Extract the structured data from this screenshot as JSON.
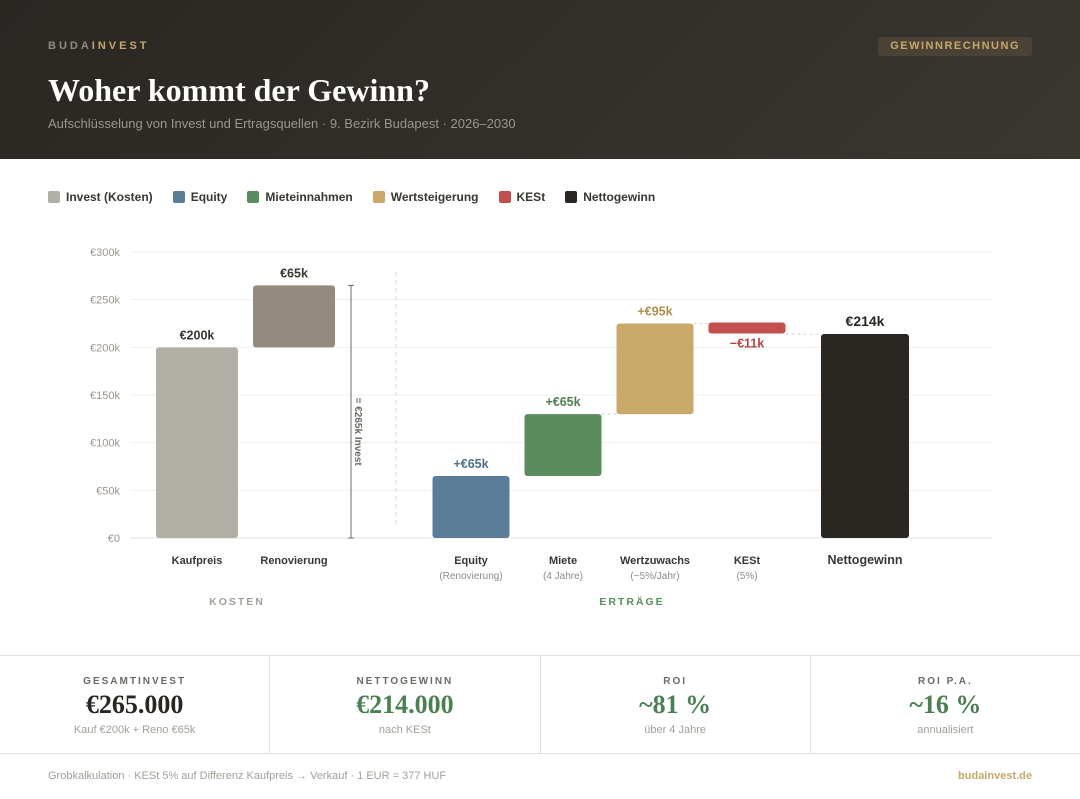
{
  "header": {
    "brand_part1": "BUDA",
    "brand_part2": "INVEST",
    "badge": "GEWINNRECHNUNG",
    "title": "Woher kommt der Gewinn?",
    "subtitle": "Aufschlüsselung von Invest und Ertragsquellen · 9. Bezirk Budapest · 2026–2030"
  },
  "legend": [
    {
      "label": "Invest (Kosten)",
      "color": "#b2afa7"
    },
    {
      "label": "Equity",
      "color": "#5b7d98"
    },
    {
      "label": "Mieteinnahmen",
      "color": "#5a8c5e"
    },
    {
      "label": "Wertsteigerung",
      "color": "#c9a96a"
    },
    {
      "label": "KESt",
      "color": "#c34f4f"
    },
    {
      "label": "Nettogewinn",
      "color": "#2a2723"
    }
  ],
  "chart_data": {
    "type": "bar",
    "subtype": "waterfall",
    "ylim": [
      0,
      300
    ],
    "yticks": [
      0,
      50,
      100,
      150,
      200,
      250,
      300
    ],
    "ytick_labels": [
      "€0",
      "€50k",
      "€100k",
      "€150k",
      "€200k",
      "€250k",
      "€300k"
    ],
    "grid": true,
    "bars": [
      {
        "category": "Kaufpreis",
        "sublabel": "",
        "base": 0,
        "top": 200,
        "value_label": "€200k",
        "color": "#b2afa7",
        "label_color": "#3a3631"
      },
      {
        "category": "Renovierung",
        "sublabel": "",
        "base": 200,
        "top": 265,
        "value_label": "€65k",
        "color": "#948b7f",
        "label_color": "#3a3631"
      },
      {
        "category": "Equity",
        "sublabel": "(Renovierung)",
        "base": 0,
        "top": 65,
        "value_label": "+€65k",
        "color": "#5b7d98",
        "label_color": "#4f6f89"
      },
      {
        "category": "Miete",
        "sublabel": "(4 Jahre)",
        "base": 65,
        "top": 130,
        "value_label": "+€65k",
        "color": "#5a8c5e",
        "label_color": "#4f7e52"
      },
      {
        "category": "Wertzuwachs",
        "sublabel": "(~5%/Jahr)",
        "base": 130,
        "top": 225,
        "value_label": "+€95k",
        "color": "#c9a96a",
        "label_color": "#b08d4a"
      },
      {
        "category": "KESt",
        "sublabel": "(5%)",
        "base": 214,
        "top": 225,
        "value_label": "−€11k",
        "color": "#c34f4f",
        "label_color": "#b54545"
      },
      {
        "category": "Nettogewinn",
        "sublabel": "",
        "base": 0,
        "top": 214,
        "value_label": "€214k",
        "color": "#2a2723",
        "label_color": "#2a2723"
      }
    ],
    "bracket": {
      "from": 0,
      "to": 265,
      "label": "= €265k Invest"
    },
    "groups": [
      {
        "label": "KOSTEN",
        "color": "#a39e96"
      },
      {
        "label": "ERTRÄGE",
        "color": "#5a8c5e"
      }
    ]
  },
  "stats": [
    {
      "label": "GESAMTINVEST",
      "value": "€265.000",
      "sub": "Kauf €200k + Reno €65k",
      "color": "#2a2723"
    },
    {
      "label": "NETTOGEWINN",
      "value": "€214.000",
      "sub": "nach KESt",
      "color": "#4a8052"
    },
    {
      "label": "ROI",
      "value": "~81 %",
      "sub": "über 4 Jahre",
      "color": "#4a8052"
    },
    {
      "label": "ROI P.A.",
      "value": "~16 %",
      "sub": "annualisiert",
      "color": "#4a8052"
    }
  ],
  "footer": {
    "note": "Grobkalkulation · KESt 5% auf Differenz Kaufpreis → Verkauf · 1 EUR = 377 HUF",
    "link": "budainvest.de"
  }
}
